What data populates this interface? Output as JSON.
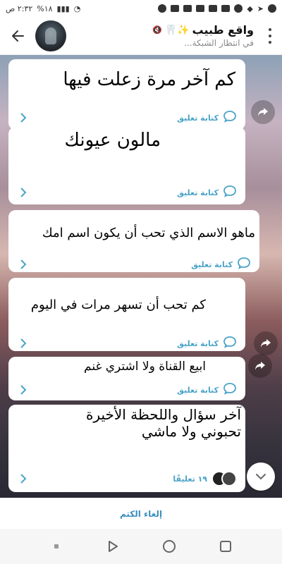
{
  "status_bar": {
    "time": "٢:٣٢ ص",
    "battery": "%١٨"
  },
  "header": {
    "title": "واقع طبيب",
    "title_emojis": "✨🦷",
    "subtitle": "في انتظار الشبكة..."
  },
  "messages": [
    {
      "text": "كم آخر مرة زعلت فيها",
      "comment_label": "كتابة تعليق"
    },
    {
      "text": "مالون عيونك",
      "comment_label": "كتابة تعليق"
    },
    {
      "text": "ماهو الاسم الذي تحب أن يكون اسم امك",
      "comment_label": "كتابة تعليق"
    },
    {
      "text": "كم تحب أن تسهر مرات في اليوم",
      "comment_label": "كتابة تعليق"
    },
    {
      "text": "ابيع القناة ولا اشتري غنم",
      "comment_label": "كتابة تعليق"
    },
    {
      "text": "آخر سؤال واللحظة الأخيرة تحبوني ولا ماشي",
      "comment_label": "١٩ تعليقًا"
    }
  ],
  "bottom_bar": {
    "unmute_label": "إلغاء الكتم"
  },
  "colors": {
    "accent": "#4aa3c7",
    "unmute": "#3a8fbf"
  }
}
